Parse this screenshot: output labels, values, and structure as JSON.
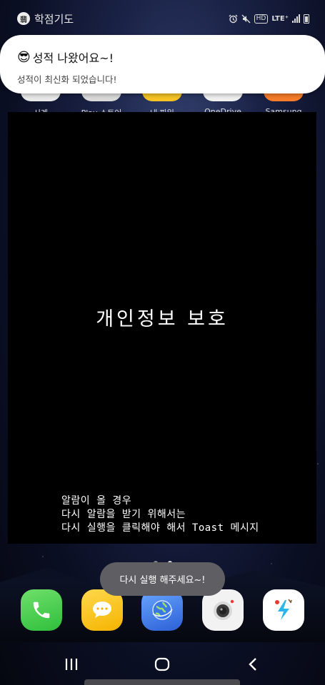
{
  "status_bar": {
    "app_label": "학점기도",
    "icons": [
      "alarm-icon",
      "mute-icon",
      "hd-voice-icon",
      "lte-icon",
      "signal-icon",
      "battery-icon"
    ],
    "hd_text": "HD",
    "lte_text": "LTE⁺"
  },
  "notification": {
    "emoji": "😎",
    "title": "성적 나왔어요~!",
    "body": "성적이 최신화 되었습니다!"
  },
  "top_apps": {
    "labels": [
      "시계",
      "Play 스토어",
      "내 파일",
      "OneDrive",
      "Samsung"
    ],
    "colors": [
      "#e8e8e8",
      "#d9d9d9",
      "#f5c326",
      "#f0f0f0",
      "#f57c2a"
    ]
  },
  "privacy_overlay": {
    "title": "개인정보 보호",
    "message_lines": [
      "알람이 올 경우",
      "다시 알람을 받기 위해서는",
      "다시 실행을 클릭해야 해서 Toast 메시지"
    ]
  },
  "page_dots": {
    "count": 2,
    "active_index": 1
  },
  "toast": {
    "text": "다시 실행 해주세요~!"
  },
  "dock": {
    "apps": [
      "phone-app",
      "messages-app",
      "browser-app",
      "camera-app",
      "custom-app"
    ]
  },
  "nav_bar": {
    "buttons": [
      "recent-apps-button",
      "home-button",
      "back-button"
    ]
  },
  "colors": {
    "notification_bg": "#ffffff",
    "overlay_bg": "#000000",
    "toast_bg": "#5f5f63"
  }
}
